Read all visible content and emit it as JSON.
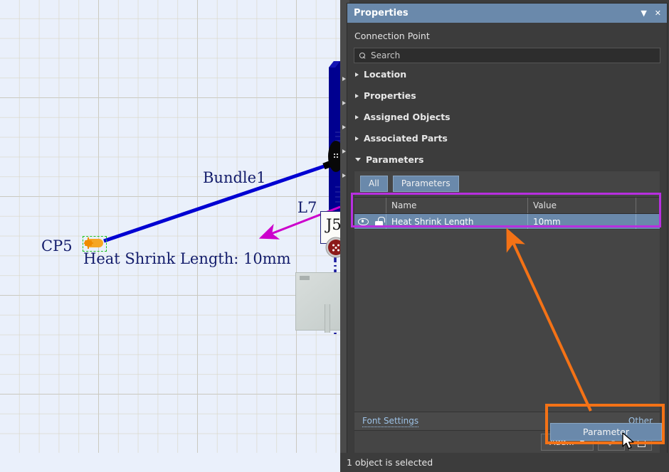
{
  "panel": {
    "title": "Properties",
    "collapse_icon": "chevron-down-icon",
    "close_icon": "close-icon",
    "subtitle": "Connection Point",
    "search": {
      "placeholder": "Search",
      "value": "",
      "icon": "search-icon"
    },
    "sections": [
      {
        "label": "Location",
        "expanded": false
      },
      {
        "label": "Properties",
        "expanded": false
      },
      {
        "label": "Assigned Objects",
        "expanded": false
      },
      {
        "label": "Associated Parts",
        "expanded": false
      },
      {
        "label": "Parameters",
        "expanded": true
      }
    ],
    "tabs": [
      {
        "label": "All",
        "active": true
      },
      {
        "label": "Parameters",
        "active": true
      }
    ],
    "table": {
      "columns": [
        "",
        "Name",
        "Value",
        ""
      ],
      "headers": {
        "name": "Name",
        "value": "Value"
      },
      "rows": [
        {
          "visibility_icon": "eye-icon",
          "lock_icon": "unlocked-padlock-icon",
          "name": "Heat Shrink Length",
          "value": "10mm",
          "selected": true
        }
      ]
    },
    "links": {
      "font_settings": "Font Settings",
      "other": "Other"
    },
    "buttons": {
      "add": "Add...",
      "add_caret": "chevron-down-icon",
      "edit": "pencil-icon",
      "delete": "trash-icon"
    },
    "dropdown": {
      "open": true,
      "items": [
        "Parameter"
      ]
    }
  },
  "canvas": {
    "labels": {
      "bundle": "Bundle1",
      "cp5": "CP5",
      "heat_shrink": "Heat Shrink Length: 10mm",
      "l7": "L7",
      "j5": "J5"
    },
    "colors": {
      "background": "#eaf0fb",
      "bundle_blue": "#0000d2",
      "harness_navy": "#00008f",
      "label_navy": "#131c6b",
      "connection_point_orange": "#f5a623",
      "selection_green": "#1fc11f",
      "connector_red": "#8c1a1a"
    }
  },
  "annotations": {
    "highlight_table_color": "#b82fe0",
    "highlight_button_color": "#f47216",
    "pointer_arrow_color": "#cc00cc"
  },
  "statusbar": {
    "text": "1 object is selected"
  }
}
